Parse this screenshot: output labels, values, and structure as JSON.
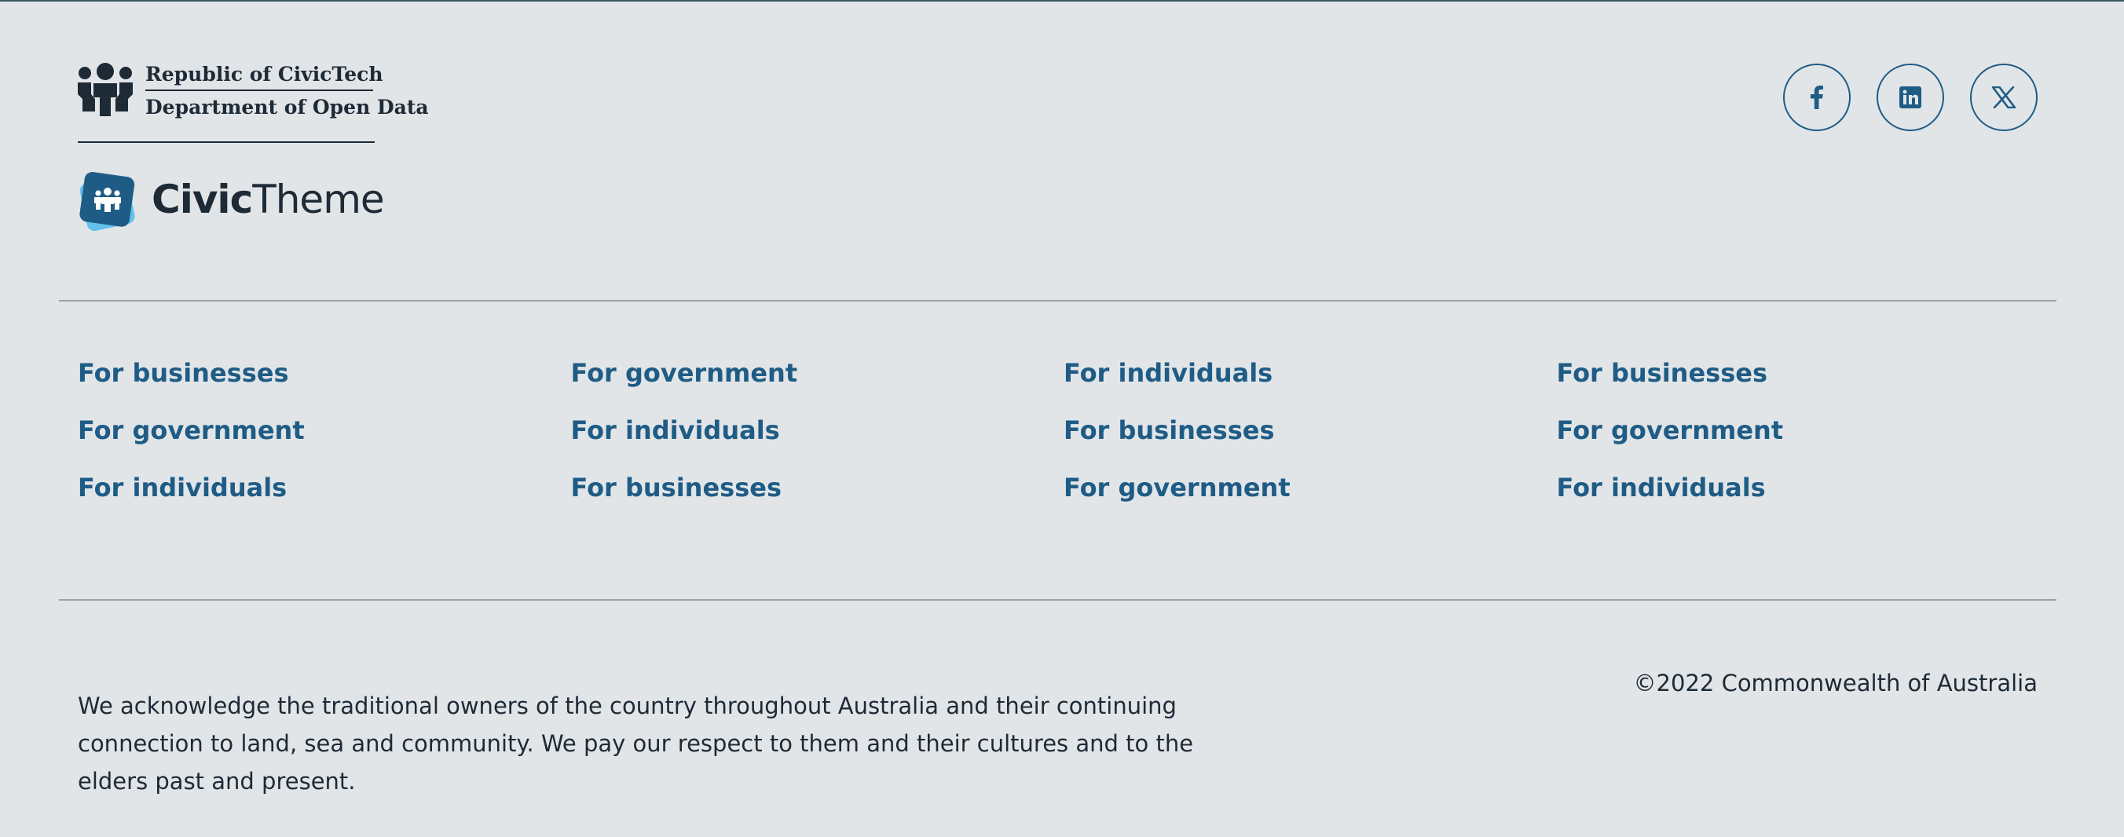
{
  "branding": {
    "gov_line1": "Republic of CivicTech",
    "gov_line2": "Department of Open Data",
    "civic_bold": "Civic",
    "civic_light": "Theme"
  },
  "social": [
    {
      "name": "facebook",
      "icon": "facebook-icon"
    },
    {
      "name": "linkedin",
      "icon": "linkedin-icon"
    },
    {
      "name": "x",
      "icon": "x-icon"
    }
  ],
  "link_columns": [
    [
      "For businesses",
      "For government",
      "For individuals"
    ],
    [
      "For government",
      "For individuals",
      "For businesses"
    ],
    [
      "For individuals",
      "For businesses",
      "For government"
    ],
    [
      "For businesses",
      "For government",
      "For individuals"
    ]
  ],
  "acknowledgement": "We acknowledge the traditional owners of the country throughout Australia and their continuing connection to land, sea and community. We pay our respect to them and their cultures and to the elders past and present.",
  "copyright": "©2022 Commonwealth of Australia",
  "colors": {
    "background": "#e1e5e8",
    "link": "#1f5c85",
    "text": "#1e2a35",
    "divider": "#9aa1a7"
  }
}
